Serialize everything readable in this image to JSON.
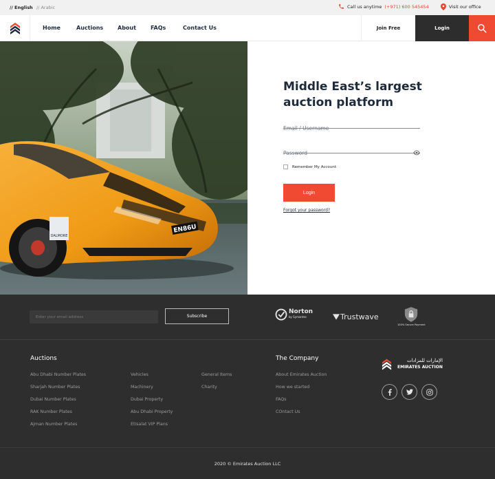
{
  "topbar": {
    "lang_en": "// English",
    "lang_ar": "// Arabic",
    "call_label": "Call us anytime",
    "phone": "(+971) 600 545454",
    "visit_label": "Visit our office"
  },
  "nav": {
    "items": [
      {
        "label": "Home"
      },
      {
        "label": "Auctions"
      },
      {
        "label": "About"
      },
      {
        "label": "FAQs"
      },
      {
        "label": "Contact Us"
      }
    ],
    "join_label": "Join Free",
    "login_label": "Login"
  },
  "hero": {
    "plate_text": "EN86U",
    "sticker_text": "DALMORE"
  },
  "login_form": {
    "headline": "Middle East’s largest auction platform",
    "username_placeholder": "Email / Username",
    "password_placeholder": "Password",
    "remember_label": "Remember My Account",
    "submit_label": "Login",
    "forgot_label": "Forgot your password?"
  },
  "newsletter": {
    "email_placeholder": "Enter your email address",
    "subscribe_label": "Subscribe"
  },
  "trust_badges": {
    "norton": "Norton",
    "norton_sub": "by Symantec",
    "trustwave": "Trustwave",
    "secure_payment": "100% Secure Payment"
  },
  "footer": {
    "auctions_title": "Auctions",
    "auction_links_col1": [
      "Abu Dhabi Number Plates",
      "Sharjah Number Plates",
      "Dubai Number Plates",
      "RAK Number Plates",
      "Ajman Number Plates"
    ],
    "auction_links_col2": [
      "Vehicles",
      "Machinery",
      "Dubai Property",
      "Abu Dhabi Property",
      "Etisalat VIP Plans"
    ],
    "auction_links_col3": [
      "General Items",
      "Charity"
    ],
    "company_title": "The Company",
    "company_links": [
      "About Emirates Auction",
      "How we started",
      "FAQs",
      "COntact Us"
    ],
    "brand_en": "EMIRATES AUCTION",
    "brand_ar": "الإمارات للمزادات",
    "copyright": "2020 © Emirates Auction LLC"
  },
  "colors": {
    "accent": "#f04a32",
    "dark": "#2e2e2e",
    "text": "#1e2a3a"
  }
}
